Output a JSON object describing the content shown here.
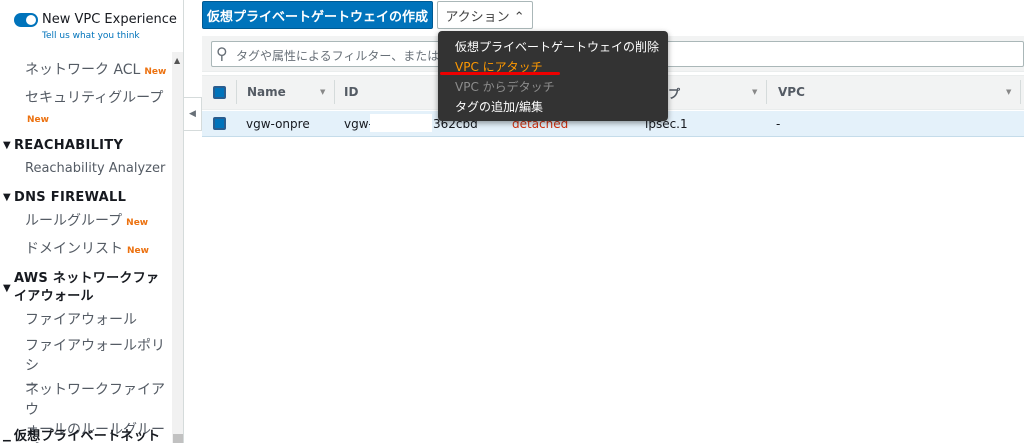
{
  "sidebar": {
    "experience_label": "New VPC Experience",
    "tell_us": "Tell us what you think",
    "new_badge": "New",
    "items": {
      "network_acl": "ネットワーク ACL",
      "security_group": "セキュリティグループ",
      "reachability_section": "REACHABILITY",
      "reachability_analyzer": "Reachability Analyzer",
      "dns_firewall_section": "DNS FIREWALL",
      "rule_group": "ルールグループ",
      "domain_list": "ドメインリスト",
      "aws_firewall_section_line1": "AWS ネットワークファ",
      "aws_firewall_section_line2": "イアウォール",
      "firewall": "ファイアウォール",
      "firewall_policy_line1": "ファイアウォールポリシ",
      "firewall_policy_line2": "ー",
      "network_firewall_rules_line1": "ネットワークファイアウ",
      "network_firewall_rules_line2": "ォールのルールグループ",
      "vpg_section": "仮想プライベートネット"
    }
  },
  "toolbar": {
    "create_label": "仮想プライベートゲートウェイの作成",
    "actions_label": "アクション ⌃"
  },
  "search": {
    "placeholder": "タグや属性によるフィルター、またはキ"
  },
  "table": {
    "columns": {
      "name": "Name",
      "id": "ID",
      "type": "プ",
      "vpc": "VPC"
    },
    "rows": [
      {
        "name": "vgw-onpre",
        "id_prefix": "vgw-0",
        "id_suffix": "362cbd",
        "state": "detached",
        "type": "ipsec.1",
        "vpc": "-"
      }
    ]
  },
  "menu": {
    "delete": "仮想プライベートゲートウェイの削除",
    "attach": "VPC にアタッチ",
    "detach": "VPC からデタッチ",
    "edit_tags": "タグの追加/編集"
  }
}
